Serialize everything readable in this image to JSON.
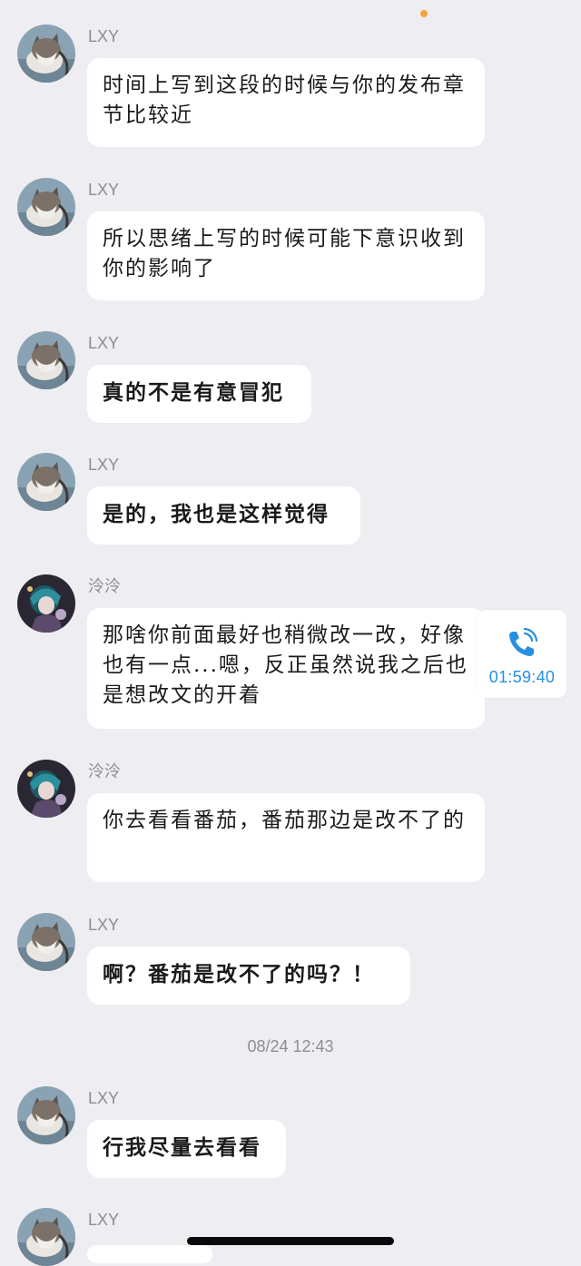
{
  "chat": {
    "messages": [
      {
        "sender": "LXY",
        "avatar": "cat-avatar",
        "text": "时间上写到这段的时候与你的发布章节比较近"
      },
      {
        "sender": "LXY",
        "avatar": "cat-avatar",
        "text": "所以思绪上写的时候可能下意识收到你的影响了"
      },
      {
        "sender": "LXY",
        "avatar": "cat-avatar",
        "text": "真的不是有意冒犯"
      },
      {
        "sender": "LXY",
        "avatar": "cat-avatar",
        "text": "是的，我也是这样觉得"
      },
      {
        "sender": "泠泠",
        "avatar": "anime-character-avatar",
        "text": "那啥你前面最好也稍微改一改，好像也有一点...嗯，反正虽然说我之后也是想改文的开着"
      },
      {
        "sender": "泠泠",
        "avatar": "anime-character-avatar",
        "text": "你去看看番茄，番茄那边是改不了的"
      },
      {
        "sender": "LXY",
        "avatar": "cat-avatar",
        "text": "啊？番茄是改不了的吗？！"
      },
      {
        "sender": "LXY",
        "avatar": "cat-avatar",
        "text": "行我尽量去看看"
      },
      {
        "sender": "LXY",
        "avatar": "cat-avatar",
        "text": ""
      }
    ],
    "call_card": {
      "icon": "phone-call-icon",
      "duration": "01:59:40"
    },
    "timestamp": "08/24 12:43"
  },
  "colors": {
    "background": "#eeedf2",
    "bubble": "#ffffff",
    "accent": "#2790e0",
    "muted_text": "#8d8d93",
    "status_dot": "#f2a43a"
  }
}
